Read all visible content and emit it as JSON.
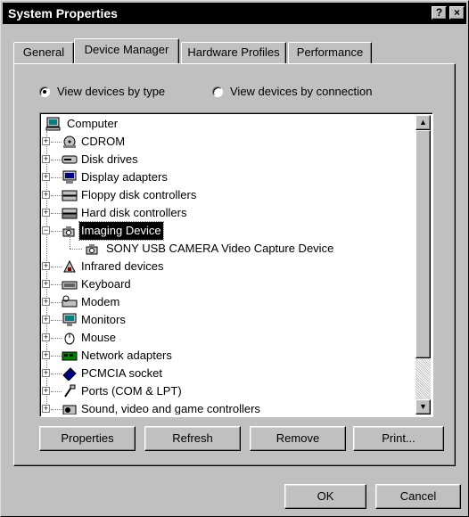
{
  "window": {
    "title": "System Properties",
    "help_glyph": "?",
    "close_glyph": "×"
  },
  "tabs": [
    {
      "label": "General",
      "active": false
    },
    {
      "label": "Device Manager",
      "active": true
    },
    {
      "label": "Hardware Profiles",
      "active": false
    },
    {
      "label": "Performance",
      "active": false
    }
  ],
  "view_options": {
    "by_type_label": "View devices by type",
    "by_connection_label": "View devices by connection",
    "selected": "by_type"
  },
  "tree": {
    "root": {
      "label": "Computer",
      "icon": "computer-icon"
    },
    "items": [
      {
        "label": "CDROM",
        "icon": "cdrom-icon",
        "expanded": false,
        "selected": false
      },
      {
        "label": "Disk drives",
        "icon": "disk-drive-icon",
        "expanded": false,
        "selected": false
      },
      {
        "label": "Display adapters",
        "icon": "display-adapter-icon",
        "expanded": false,
        "selected": false
      },
      {
        "label": "Floppy disk controllers",
        "icon": "floppy-controller-icon",
        "expanded": false,
        "selected": false
      },
      {
        "label": "Hard disk controllers",
        "icon": "hard-disk-controller-icon",
        "expanded": false,
        "selected": false
      },
      {
        "label": "Imaging Device",
        "icon": "imaging-device-icon",
        "expanded": true,
        "selected": true,
        "children": [
          {
            "label": "SONY USB CAMERA Video Capture Device",
            "icon": "camera-icon"
          }
        ]
      },
      {
        "label": "Infrared devices",
        "icon": "infrared-icon",
        "expanded": false,
        "selected": false
      },
      {
        "label": "Keyboard",
        "icon": "keyboard-icon",
        "expanded": false,
        "selected": false
      },
      {
        "label": "Modem",
        "icon": "modem-icon",
        "expanded": false,
        "selected": false
      },
      {
        "label": "Monitors",
        "icon": "monitor-icon",
        "expanded": false,
        "selected": false
      },
      {
        "label": "Mouse",
        "icon": "mouse-icon",
        "expanded": false,
        "selected": false
      },
      {
        "label": "Network adapters",
        "icon": "network-adapter-icon",
        "expanded": false,
        "selected": false
      },
      {
        "label": "PCMCIA socket",
        "icon": "pcmcia-icon",
        "expanded": false,
        "selected": false
      },
      {
        "label": "Ports (COM & LPT)",
        "icon": "port-icon",
        "expanded": false,
        "selected": false
      },
      {
        "label": "Sound, video and game controllers",
        "icon": "sound-icon",
        "expanded": false,
        "selected": false
      }
    ]
  },
  "panel_buttons": {
    "properties": "Properties",
    "refresh": "Refresh",
    "remove": "Remove",
    "print": "Print..."
  },
  "dialog_buttons": {
    "ok": "OK",
    "cancel": "Cancel"
  }
}
